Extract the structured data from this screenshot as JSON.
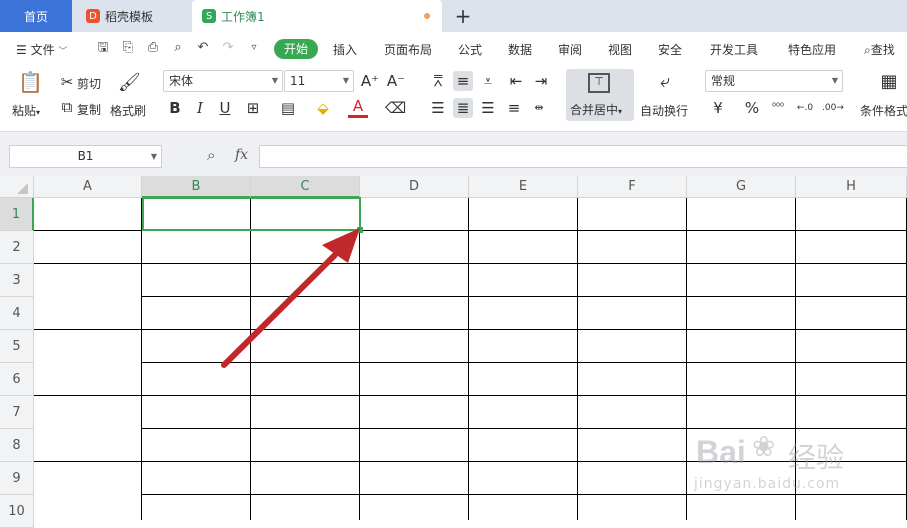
{
  "tabs": {
    "home": "首页",
    "template": "稻壳模板",
    "workbook": "工作簿1",
    "template_icon": "D",
    "workbook_icon": "S",
    "add": "+"
  },
  "menu": {
    "file": "文件",
    "items": [
      "开始",
      "插入",
      "页面布局",
      "公式",
      "数据",
      "审阅",
      "视图",
      "安全",
      "开发工具",
      "特色应用"
    ],
    "search": "查找"
  },
  "ribbon": {
    "paste": "粘贴",
    "cut": "剪切",
    "copy": "复制",
    "format_painter": "格式刷",
    "font_name": "宋体",
    "font_size": "11",
    "bold": "B",
    "italic": "I",
    "underline": "U",
    "font_color_letter": "A",
    "merge_center": "合并居中",
    "wrap_text": "自动换行",
    "number_format": "常规",
    "percent": "%",
    "conditional_format": "条件格式"
  },
  "formula_bar": {
    "name_box": "B1",
    "fx": "fx",
    "content": ""
  },
  "sheet": {
    "columns": [
      "A",
      "B",
      "C",
      "D",
      "E",
      "F",
      "G",
      "H"
    ],
    "rows": [
      "1",
      "2",
      "3",
      "4",
      "5",
      "6",
      "7",
      "8",
      "9",
      "10"
    ],
    "selected_columns": [
      "B",
      "C"
    ],
    "selected_row": "1"
  },
  "watermark": {
    "brand": "Bai",
    "suffix": "经验",
    "url": "jingyan.baidu.com"
  },
  "colors": {
    "accent_green": "#3aa853",
    "home_tab_blue": "#3b73d8",
    "arrow_red": "#c0282b"
  }
}
